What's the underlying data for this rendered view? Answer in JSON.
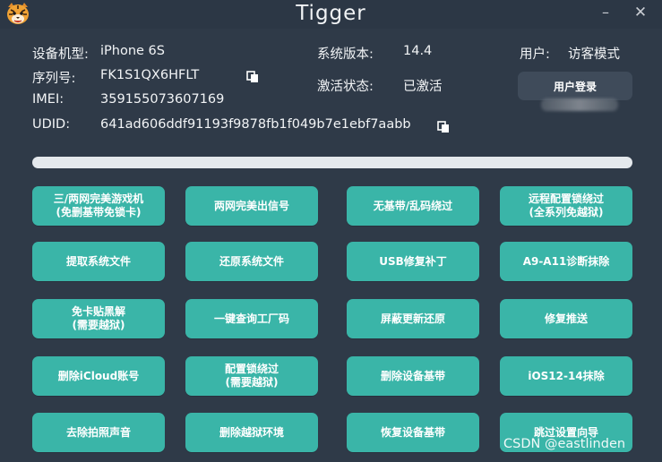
{
  "app": {
    "title": "Tigger"
  },
  "window": {
    "minimize": "–",
    "close": "✕"
  },
  "device": {
    "model_label": "设备机型:",
    "model_value": "iPhone 6S",
    "serial_label": "序列号:",
    "serial_value": "FK1S1QX6HFLT",
    "imei_label": "IMEI:",
    "imei_value": "359155073607169",
    "udid_label": "UDID:",
    "udid_value": "641ad606ddf91193f9878fb1f049b7e1ebf7aabb",
    "version_label": "系统版本:",
    "version_value": "14.4",
    "activation_label": "激活状态:",
    "activation_value": "已激活"
  },
  "user": {
    "label": "用户:",
    "value": "访客模式",
    "login_button": "用户登录"
  },
  "progress": {
    "fraction": 0
  },
  "buttons": [
    "三/两网完美游戏机\n(免删基带免锁卡)",
    "两网完美出信号",
    "无基带/乱码绕过",
    "远程配置锁绕过\n(全系列免越狱)",
    "提取系统文件",
    "还原系统文件",
    "USB修复补丁",
    "A9-A11诊断抹除",
    "免卡贴黑解\n(需要越狱)",
    "一键查询工厂码",
    "屏蔽更新还原",
    "修复推送",
    "删除iCloud账号",
    "配置锁绕过\n(需要越狱)",
    "删除设备基带",
    "iOS12-14抹除",
    "去除拍照声音",
    "删除越狱环境",
    "恢复设备基带",
    "跳过设置向导"
  ],
  "watermark": "CSDN @eastlinden",
  "colors": {
    "background": "#2f3a48",
    "button": "#3ab5a8",
    "progress_track": "#e4e8ec"
  },
  "icons": {
    "logo": "tiger-logo-icon",
    "copy": "copy-icon"
  }
}
